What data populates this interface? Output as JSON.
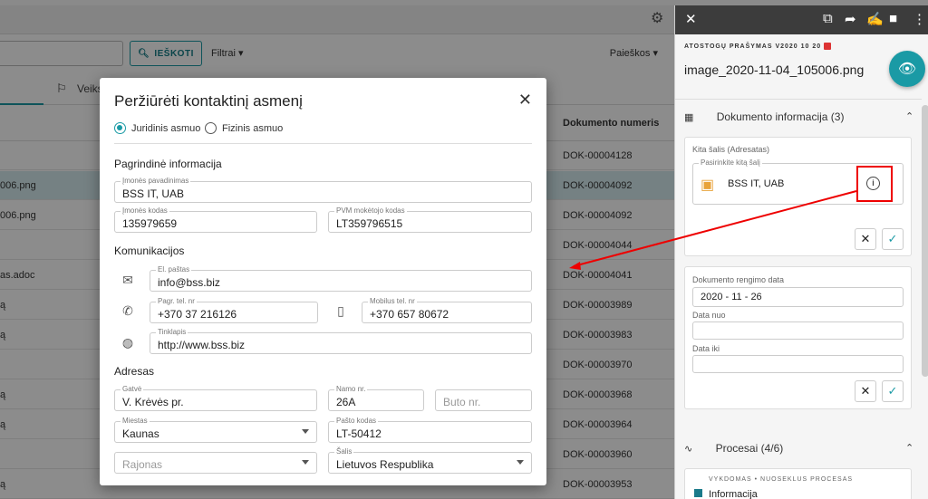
{
  "background": {
    "search_button": "IEŠKOTI",
    "filters": "Filtrai",
    "saved_searches": "Paieškos",
    "tab_label": "Veiks",
    "column_doc_number": "Dokumento numeris",
    "rows": [
      {
        "left": "",
        "doc": "DOK-00004128",
        "selected": false
      },
      {
        "left": "006.png",
        "doc": "DOK-00004092",
        "selected": true
      },
      {
        "left": "006.png",
        "doc": "DOK-00004092",
        "selected": false
      },
      {
        "left": "",
        "doc": "DOK-00004044",
        "selected": false
      },
      {
        "left": "as.adoc",
        "doc": "DOK-00004041",
        "selected": false
      },
      {
        "left": "ą",
        "doc": "DOK-00003989",
        "selected": false
      },
      {
        "left": "ą",
        "doc": "DOK-00003983",
        "selected": false
      },
      {
        "left": "",
        "doc": "DOK-00003970",
        "selected": false
      },
      {
        "left": "ą",
        "doc": "DOK-00003968",
        "selected": false
      },
      {
        "left": "ą",
        "doc": "DOK-00003964",
        "selected": false
      },
      {
        "left": "",
        "doc": "DOK-00003960",
        "selected": false
      },
      {
        "left": "ą",
        "doc": "DOK-00003953",
        "selected": false
      }
    ]
  },
  "dialog": {
    "title": "Peržiūrėti kontaktinį asmenį",
    "radio_legal": "Juridinis asmuo",
    "radio_natural": "Fizinis asmuo",
    "section_main": "Pagrindinė informacija",
    "company_name_label": "Įmonės pavadinimas",
    "company_name": "BSS IT, UAB",
    "company_code_label": "Įmonės kodas",
    "company_code": "135979659",
    "vat_label": "PVM mokėtojo kodas",
    "vat": "LT359796515",
    "section_comm": "Komunikacijos",
    "email_label": "El. paštas",
    "email": "info@bss.biz",
    "phone_label": "Pagr. tel. nr",
    "phone": "+370 37 216126",
    "mobile_label": "Mobilus tel. nr",
    "mobile": "+370 657 80672",
    "web_label": "Tinklapis",
    "web": "http://www.bss.biz",
    "section_address": "Adresas",
    "street_label": "Gatvė",
    "street": "V. Krėvės pr.",
    "house_label": "Namo nr.",
    "house": "26A",
    "flat_placeholder": "Buto nr.",
    "city_label": "Miestas",
    "city": "Kaunas",
    "postal_label": "Pašto kodas",
    "postal": "LT-50412",
    "district_placeholder": "Rajonas",
    "country_label": "Šalis",
    "country": "Lietuvos Respublika"
  },
  "panel": {
    "subtitle": "ATOSTOGŲ PRAŠYMAS V2020 10 20",
    "filename": "image_2020-11-04_105006.png",
    "doc_info": "Dokumento informacija (3)",
    "other_party_caption": "Kita šalis (Adresatas)",
    "other_party_label": "Pasirinkite kitą šalį",
    "other_party_value": "BSS IT, UAB",
    "prep_date_label": "Dokumento rengimo data",
    "prep_date": "2020 - 11 - 26",
    "date_from": "Data nuo",
    "date_to": "Data iki",
    "processes": "Procesai (4/6)",
    "process_status": "VYKDOMAS • NUOSEKLUS PROCESAS",
    "process_name": "Informacija"
  },
  "colors": {
    "accent": "#1a9aa5",
    "annotation": "#e00000"
  }
}
